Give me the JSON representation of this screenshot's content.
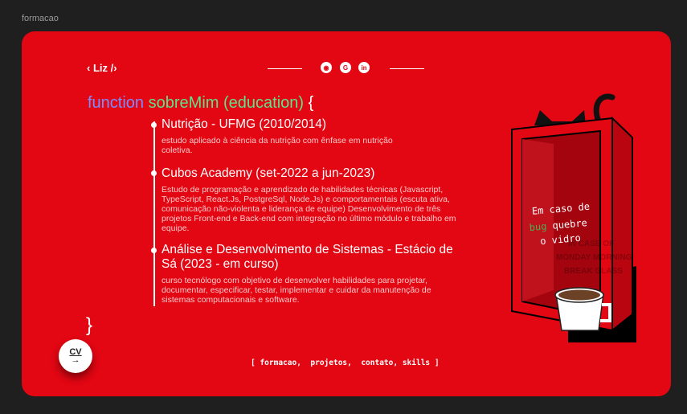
{
  "window_title": "formacao",
  "header": {
    "logo": "‹ Liz /›",
    "social": [
      {
        "icon": "github-icon",
        "glyph": "◉"
      },
      {
        "icon": "google-icon",
        "glyph": "G"
      },
      {
        "icon": "linkedin-icon",
        "glyph": "in"
      }
    ]
  },
  "heading": {
    "keyword": "function",
    "name": "sobreMim",
    "param": "(education)",
    "open": "{",
    "close": "}"
  },
  "education": [
    {
      "title": "Nutrição - UFMG (2010/2014)",
      "description": "estudo aplicado à ciência da nutrição com ênfase em nutrição coletiva."
    },
    {
      "title": "Cubos Academy  (set-2022 a jun-2023)",
      "description": "Estudo de programação e aprendizado de habilidades técnicas (Javascript, TypeScript, React.Js, PostgreSql, Node.Js) e comportamentais (escuta ativa, comunicação não-violenta e liderança de equipe) Desenvolvimento de três projetos Front-end e Back-end com integração no último módulo e trabalho em equipe."
    },
    {
      "title": "Análise e Desenvolvimento de Sistemas - Estácio de Sá (2023 - em curso)",
      "description": "curso tecnólogo com objetivo de desenvolver habilidades para projetar, documentar, especificar, testar, implementar e cuidar da manutenção de sistemas computacionais e software."
    }
  ],
  "cv_button": {
    "label": "CV",
    "arrow": "→"
  },
  "nav": {
    "open": "[ ",
    "items": [
      "formacao",
      "projetos",
      "contato",
      "skills"
    ],
    "close": " ]"
  },
  "illustration": {
    "line1": "Em caso de",
    "bug": "bug",
    "line2": " quebre",
    "line3": "o vidro",
    "bg_text": [
      "IN CASE OF",
      "MONDAY MORNING",
      "BREAK GLASS"
    ]
  },
  "colors": {
    "card": "#e30613",
    "keyword": "#7b8cff",
    "name": "#5ee38a",
    "bug": "#4caf50"
  }
}
